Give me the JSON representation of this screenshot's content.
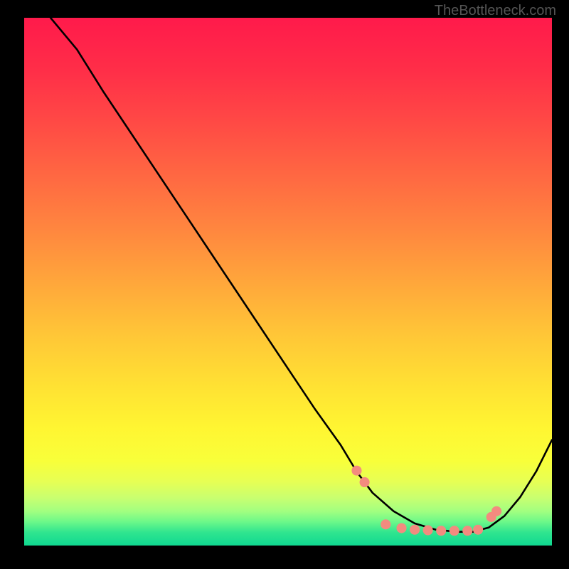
{
  "watermark": "TheBottleneck.com",
  "gradient_stops": [
    {
      "offset": 0.0,
      "color": "#ff1a4b"
    },
    {
      "offset": 0.1,
      "color": "#ff2e48"
    },
    {
      "offset": 0.2,
      "color": "#ff4a45"
    },
    {
      "offset": 0.3,
      "color": "#ff6842"
    },
    {
      "offset": 0.4,
      "color": "#ff863f"
    },
    {
      "offset": 0.5,
      "color": "#ffa63b"
    },
    {
      "offset": 0.6,
      "color": "#ffc637"
    },
    {
      "offset": 0.7,
      "color": "#ffe233"
    },
    {
      "offset": 0.78,
      "color": "#fff632"
    },
    {
      "offset": 0.84,
      "color": "#f8ff3a"
    },
    {
      "offset": 0.88,
      "color": "#e6ff55"
    },
    {
      "offset": 0.91,
      "color": "#c8ff70"
    },
    {
      "offset": 0.935,
      "color": "#a2ff80"
    },
    {
      "offset": 0.955,
      "color": "#6cf889"
    },
    {
      "offset": 0.975,
      "color": "#30e58f"
    },
    {
      "offset": 1.0,
      "color": "#0fd890"
    }
  ],
  "chart_data": {
    "type": "line",
    "title": "",
    "xlabel": "",
    "ylabel": "",
    "xlim": [
      0,
      100
    ],
    "ylim": [
      0,
      100
    ],
    "legend": false,
    "grid": false,
    "series": [
      {
        "name": "bottleneck-curve",
        "x": [
          5,
          10,
          15,
          20,
          25,
          30,
          35,
          40,
          45,
          50,
          55,
          60,
          63,
          66,
          70,
          74,
          78,
          82,
          85,
          88,
          91,
          94,
          97,
          100
        ],
        "y": [
          100,
          94,
          86,
          78.5,
          71,
          63.5,
          56,
          48.5,
          41,
          33.5,
          26,
          19,
          14,
          10,
          6.5,
          4.2,
          3.0,
          2.6,
          2.6,
          3.4,
          5.6,
          9.2,
          14,
          20
        ]
      }
    ],
    "markers": {
      "name": "highlight-dots",
      "color": "#f38b7f",
      "x": [
        63,
        64.5,
        68.5,
        71.5,
        74.0,
        76.5,
        79.0,
        81.5,
        84.0,
        86.0,
        88.5,
        89.5
      ],
      "y": [
        14.2,
        12.0,
        4.0,
        3.3,
        3.0,
        2.9,
        2.8,
        2.8,
        2.8,
        3.0,
        5.4,
        6.5
      ]
    }
  }
}
